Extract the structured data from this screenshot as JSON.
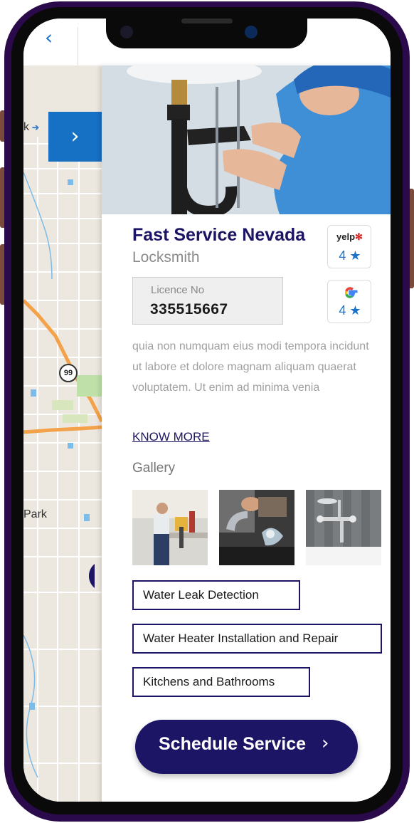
{
  "nav": {
    "back_icon": "‹",
    "expand_icon": "›"
  },
  "map": {
    "labels": [
      "k",
      "Park"
    ],
    "route_badge": "99"
  },
  "business": {
    "name": "Fast Service Nevada",
    "category": "Locksmith",
    "licence_label": "Licence No",
    "licence_number": "335515667",
    "description": "quia non numquam eius modi tempora incidunt ut labore et dolore magnam aliquam quaerat voluptatem. Ut enim ad minima venia",
    "know_more": "KNOW MORE"
  },
  "ratings": [
    {
      "source": "yelp",
      "source_text": "yelp",
      "score": "4 ★"
    },
    {
      "source": "google",
      "score": "4 ★"
    }
  ],
  "gallery": {
    "title": "Gallery",
    "images": [
      "plumber-working-photo",
      "faucet-water-photo",
      "bathtub-faucet-photo"
    ]
  },
  "services": [
    "Water Leak Detection",
    "Water Heater Installation and Repair",
    "Kitchens and Bathrooms"
  ],
  "cta": {
    "label": "Schedule Service",
    "icon": "›"
  },
  "colors": {
    "brand": "#1c1464",
    "accent": "#1670c4",
    "frame": "#2a0a4a"
  }
}
